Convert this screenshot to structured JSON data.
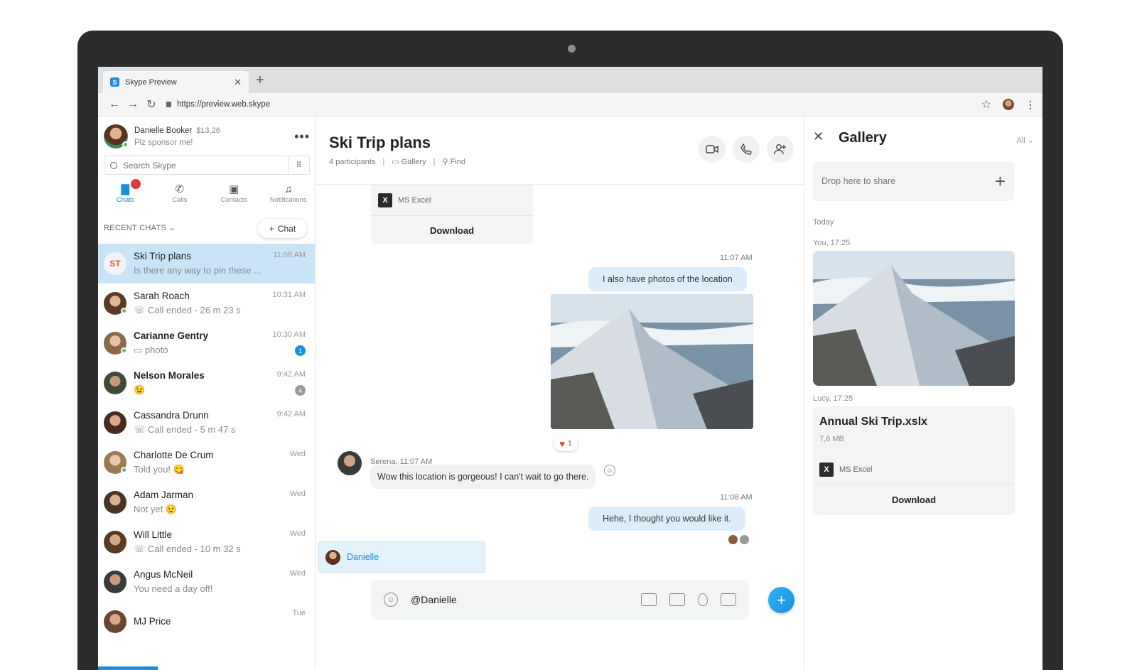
{
  "browser": {
    "tab_title": "Skype Preview",
    "url": "https://preview.web.skype"
  },
  "profile": {
    "name": "Danielle Booker",
    "credit": "$13,26",
    "mood": "Plz sponsor me!"
  },
  "search": {
    "placeholder": "Search Skype"
  },
  "nav": {
    "chats": "Chats",
    "chats_badge": "2",
    "calls": "Calls",
    "contacts": "Contacts",
    "notifications": "Notifications"
  },
  "recent": {
    "header": "RECENT CHATS",
    "new_chat": "Chat"
  },
  "chats": [
    {
      "initials": "ST",
      "name": "Ski Trip plans",
      "msg": "Is there any way to pin these ...",
      "time": "11:08 AM",
      "unread": ""
    },
    {
      "name": "Sarah Roach",
      "msg": "Call ended - 26 m 23 s",
      "time": "10:31 AM",
      "unread": ""
    },
    {
      "name": "Carianne Gentry",
      "msg": "photo",
      "time": "10:30 AM",
      "unread": "1"
    },
    {
      "name": "Nelson Morales",
      "msg": "😉",
      "time": "9:42 AM",
      "unread": "4"
    },
    {
      "name": "Cassandra Drunn",
      "msg": "Call ended - 5 m 47 s",
      "time": "9:42 AM",
      "unread": ""
    },
    {
      "name": "Charlotte De Crum",
      "msg": "Told you! 😋",
      "time": "Wed",
      "unread": ""
    },
    {
      "name": "Adam Jarman",
      "msg": "Not yet 😟",
      "time": "Wed",
      "unread": ""
    },
    {
      "name": "Will Little",
      "msg": "Call ended - 10 m 32 s",
      "time": "Wed",
      "unread": ""
    },
    {
      "name": "Angus McNeil",
      "msg": "You need a day off!",
      "time": "Wed",
      "unread": ""
    },
    {
      "name": "MJ Price",
      "msg": "",
      "time": "Tue",
      "unread": ""
    }
  ],
  "conversation": {
    "title": "Ski Trip plans",
    "participants": "4 participants",
    "gallery": "Gallery",
    "find": "Find",
    "file_type": "MS Excel",
    "download": "Download",
    "ts1": "11:07 AM",
    "msg1": "I also have photos of the location",
    "reaction_count": "1",
    "sender": "Serena, 11:07 AM",
    "msg2": "Wow this location is gorgeous! I can't wait to go there.",
    "ts2": "11:08 AM",
    "msg3": "Hehe, I thought you would like it.",
    "mention": "Danielle",
    "composer_value": "@Danielle"
  },
  "gallery": {
    "title": "Gallery",
    "filter": "All",
    "drop": "Drop here to share",
    "today": "Today",
    "photo_meta": "You, 17:25",
    "file_meta": "Lucy, 17:25",
    "file_name": "Annual Ski Trip.xslx",
    "file_size": "7,6 MB",
    "file_type": "MS Excel",
    "download": "Download"
  },
  "colors": {
    "accent": "#1a8fe0",
    "active_chat": "#c9e4f7",
    "bubble_out": "#dcedf9"
  }
}
